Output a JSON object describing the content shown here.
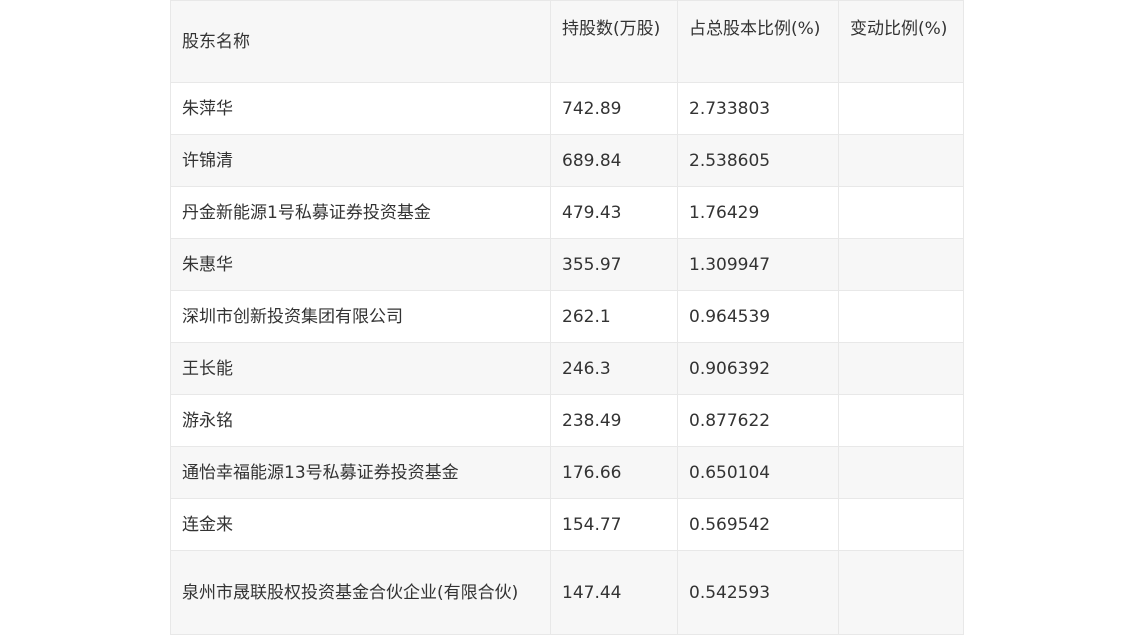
{
  "table": {
    "headers": {
      "name": "股东名称",
      "shares": "持股数(万股)",
      "ratio": "占总股本比例(%)",
      "change": "变动比例(%)"
    },
    "rows": [
      {
        "name": "朱萍华",
        "shares": "742.89",
        "ratio": "2.733803",
        "change": ""
      },
      {
        "name": "许锦清",
        "shares": "689.84",
        "ratio": "2.538605",
        "change": ""
      },
      {
        "name": "丹金新能源1号私募证券投资基金",
        "shares": "479.43",
        "ratio": "1.76429",
        "change": ""
      },
      {
        "name": "朱惠华",
        "shares": "355.97",
        "ratio": "1.309947",
        "change": ""
      },
      {
        "name": "深圳市创新投资集团有限公司",
        "shares": "262.1",
        "ratio": "0.964539",
        "change": ""
      },
      {
        "name": "王长能",
        "shares": "246.3",
        "ratio": "0.906392",
        "change": ""
      },
      {
        "name": "游永铭",
        "shares": "238.49",
        "ratio": "0.877622",
        "change": ""
      },
      {
        "name": "通怡幸福能源13号私募证券投资基金",
        "shares": "176.66",
        "ratio": "0.650104",
        "change": ""
      },
      {
        "name": "连金来",
        "shares": "154.77",
        "ratio": "0.569542",
        "change": ""
      },
      {
        "name": "泉州市晟联股权投资基金合伙企业(有限合伙)",
        "shares": "147.44",
        "ratio": "0.542593",
        "change": ""
      }
    ]
  }
}
